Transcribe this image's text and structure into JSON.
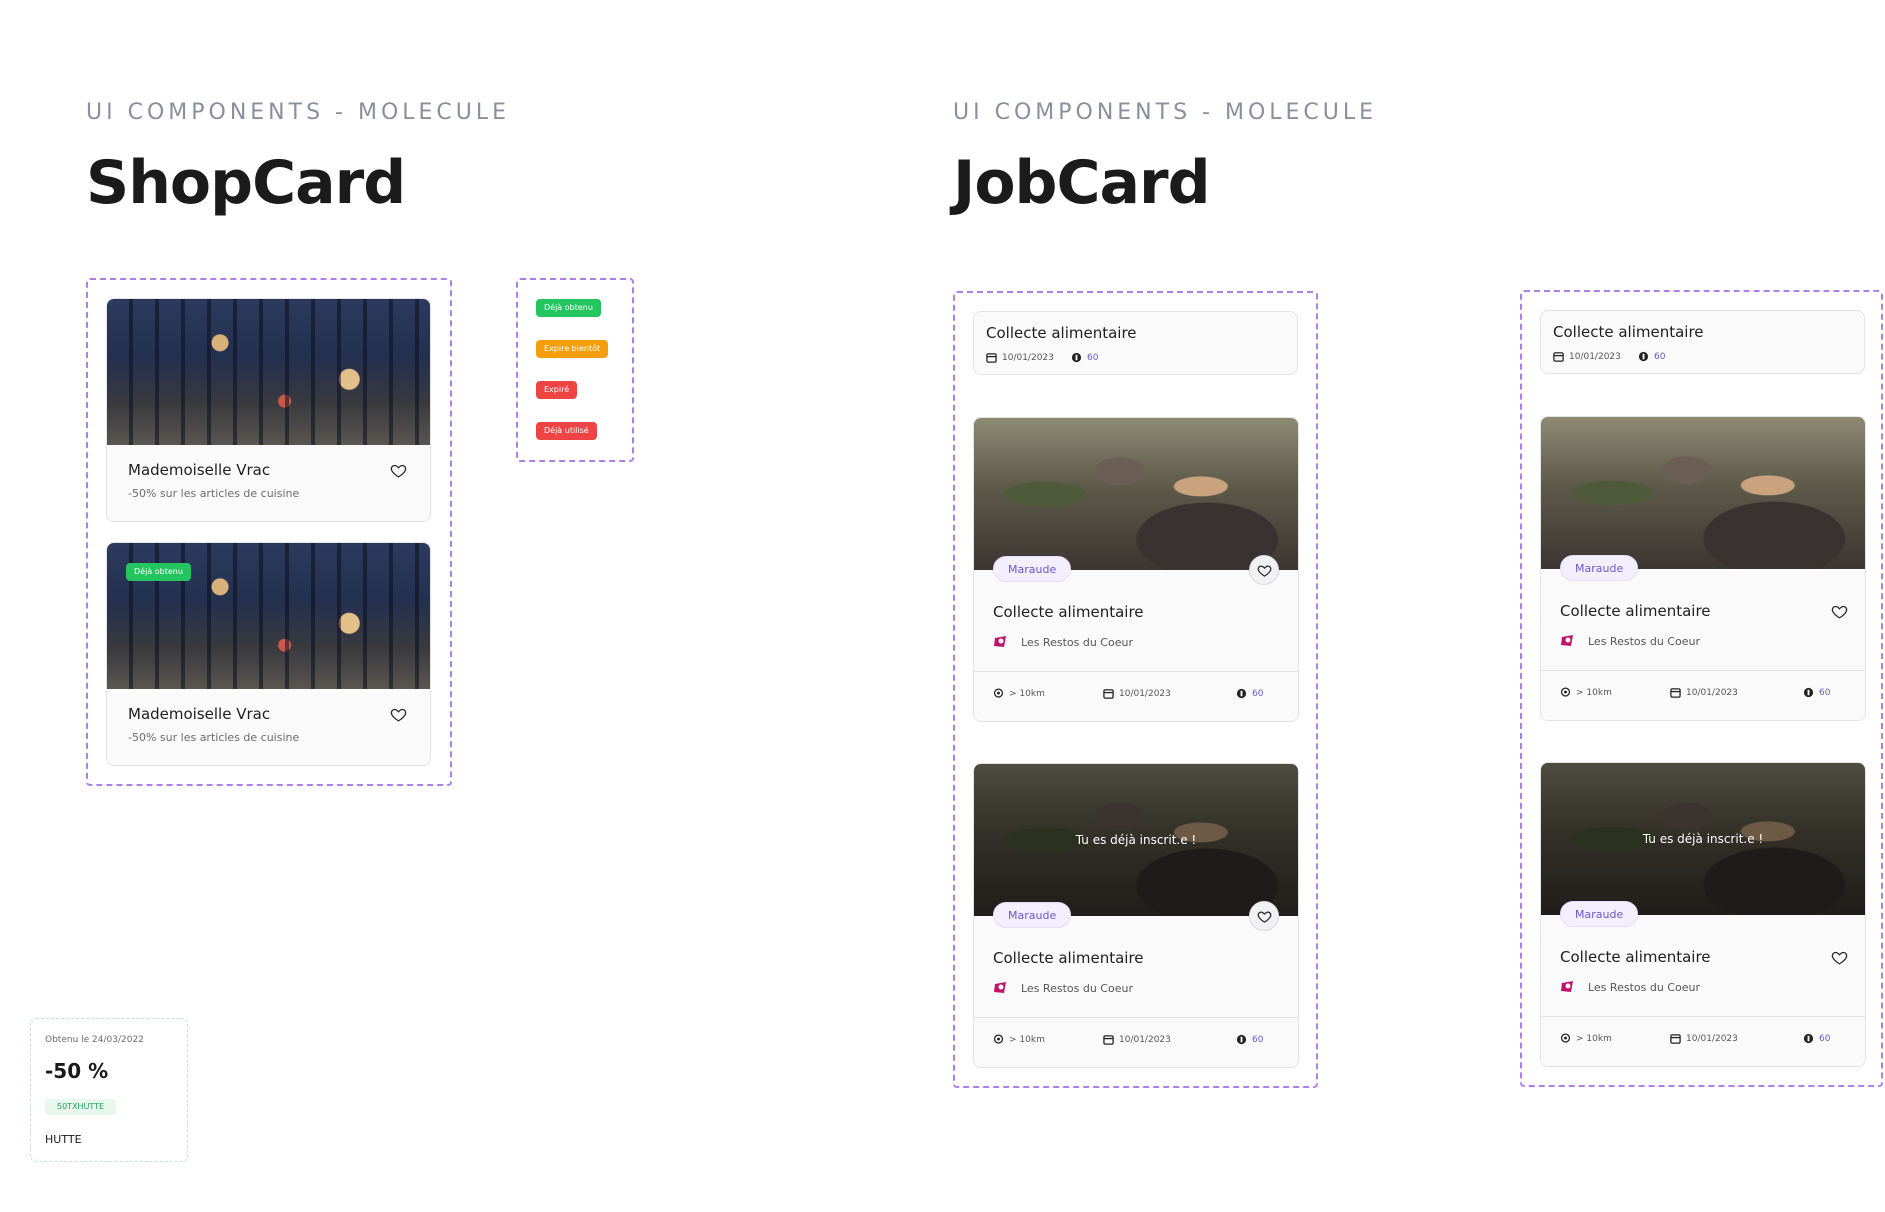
{
  "sections": {
    "shop": {
      "eyebrow": "UI COMPONENTS - MOLECULE",
      "title": "ShopCard"
    },
    "job": {
      "eyebrow": "UI COMPONENTS - MOLECULE",
      "title": "JobCard"
    }
  },
  "shop_cards": [
    {
      "name": "Mademoiselle Vrac",
      "offer": "-50% sur les articles de cuisine"
    },
    {
      "badge": "Déjà obtenu",
      "name": "Mademoiselle Vrac",
      "offer": "-50% sur les articles de cuisine"
    }
  ],
  "status_badges": [
    {
      "label": "Déjà obtenu",
      "color": "#22c55e"
    },
    {
      "label": "Expire bientôt",
      "color": "#f59e0b"
    },
    {
      "label": "Expiré",
      "color": "#ef4444"
    },
    {
      "label": "Déjà utilisé",
      "color": "#ef4444"
    }
  ],
  "coupon": {
    "date": "Obtenu le 24/03/2022",
    "discount": "-50 %",
    "code": "50TXHUTTE",
    "shop": "HUTTE"
  },
  "job_compact": {
    "title": "Collecte alimentaire",
    "date": "10/01/2023",
    "points": "60"
  },
  "job_card": {
    "tag": "Maraude",
    "title": "Collecte alimentaire",
    "org": "Les Restos du Coeur",
    "distance": "> 10km",
    "date": "10/01/2023",
    "points": "60",
    "registered": "Tu es déjà inscrit.e !"
  },
  "colors": {
    "accent": "#6b57c9",
    "dashed_frame": "#b07ee8",
    "badge_green": "#22c55e"
  }
}
